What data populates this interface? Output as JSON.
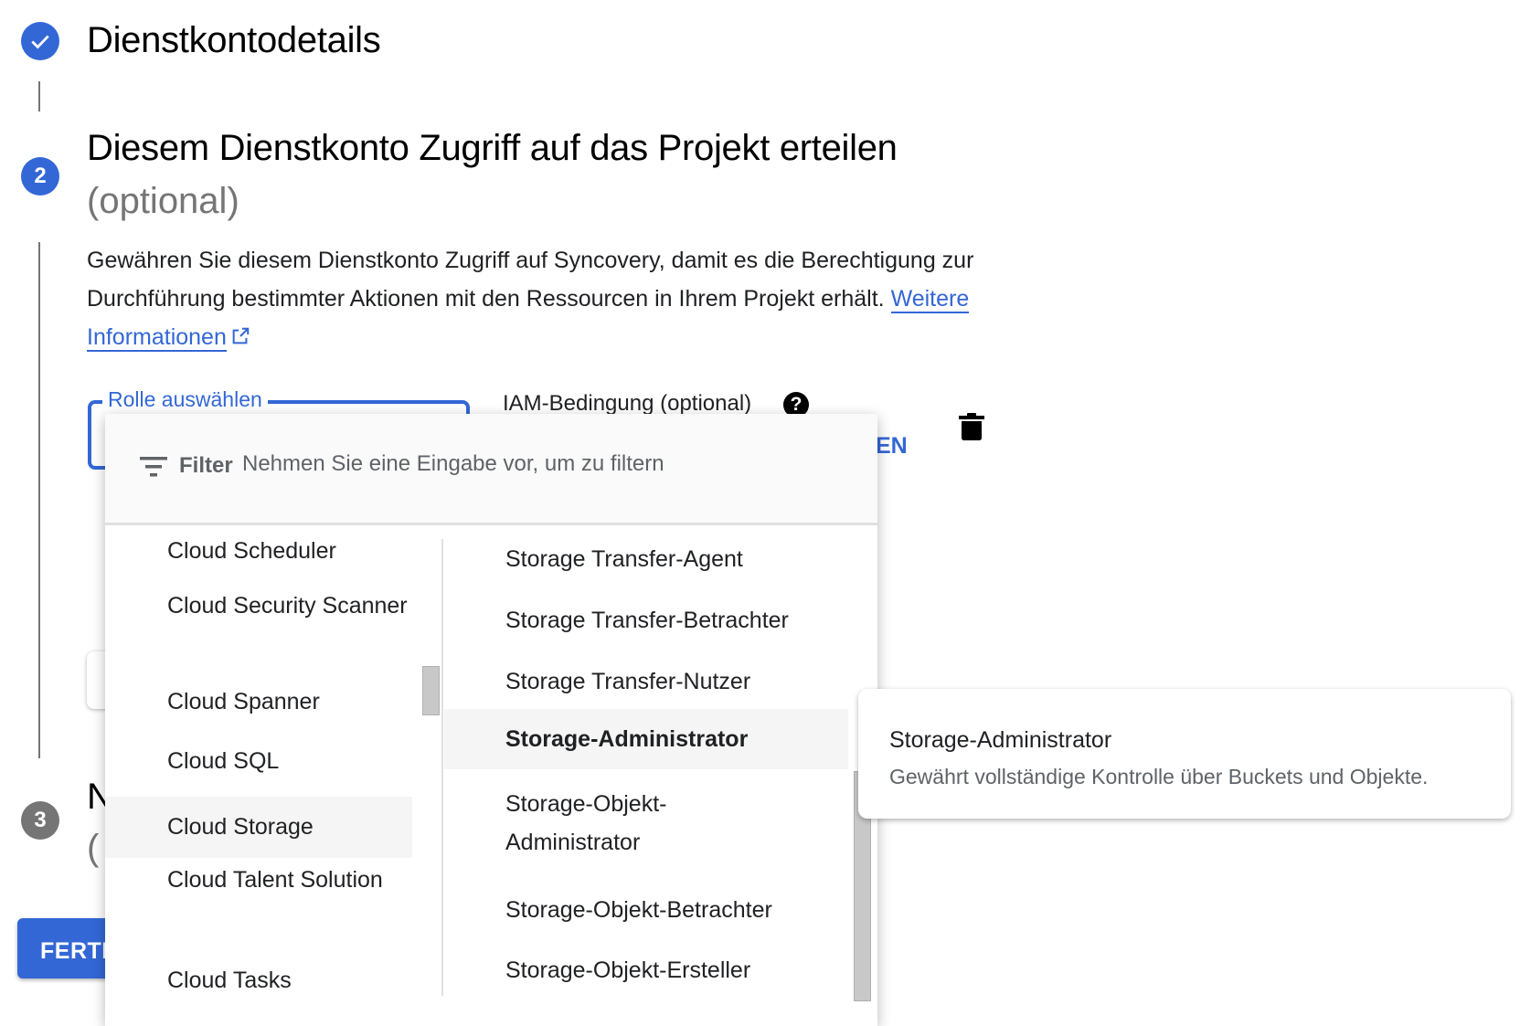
{
  "stepper": {
    "steps": [
      {
        "number": "",
        "state": "completed",
        "icon": "check-icon",
        "title": "Dienstkontodetails",
        "subtitle": ""
      },
      {
        "number": "2",
        "state": "active",
        "title": "Diesem Dienstkonto Zugriff auf das Projekt erteilen",
        "subtitle": "(optional)"
      },
      {
        "number": "3",
        "state": "pending",
        "title": "N",
        "subtitle": "("
      }
    ]
  },
  "step2": {
    "description": "Gewähren Sie diesem Dienstkonto Zugriff auf Syncovery, damit es die Berechtigung zur Durchführung bestimmter Aktionen mit den Ressourcen in Ihrem Projekt erhält.",
    "link_label": "Weitere Informationen",
    "link_icon": "external-link-icon",
    "role_field_label": "Rolle auswählen",
    "iam_condition_label": "IAM-Bedingung (optional)",
    "help_icon": "help-icon",
    "add_condition_label_visible": "EN",
    "delete_icon": "trash-icon"
  },
  "done_button_label_visible": "FERTI",
  "role_dropdown": {
    "filter_label": "Filter",
    "filter_placeholder": "Nehmen Sie eine Eingabe vor, um zu filtern",
    "filter_value": "",
    "services": [
      {
        "label": "Cloud Scheduler",
        "highlighted": false
      },
      {
        "label": "Cloud Security Scanner",
        "highlighted": false
      },
      {
        "label": "Cloud Spanner",
        "highlighted": false
      },
      {
        "label": "Cloud SQL",
        "highlighted": false
      },
      {
        "label": "Cloud Storage",
        "highlighted": true
      },
      {
        "label": "Cloud Talent Solution",
        "highlighted": false
      },
      {
        "label": "Cloud Tasks",
        "highlighted": false
      }
    ],
    "roles": [
      {
        "label": "Storage Transfer-Agent",
        "highlighted": false
      },
      {
        "label": "Storage Transfer-Betrachter",
        "highlighted": false
      },
      {
        "label": "Storage Transfer-Nutzer",
        "highlighted": false
      },
      {
        "label": "Storage-Administrator",
        "highlighted": true
      },
      {
        "label": "Storage-Objekt-Administrator",
        "highlighted": false
      },
      {
        "label": "Storage-Objekt-Betrachter",
        "highlighted": false
      },
      {
        "label": "Storage-Objekt-Ersteller",
        "highlighted": false
      }
    ]
  },
  "tooltip": {
    "title": "Storage-Administrator",
    "description": "Gewährt vollständige Kontrolle über Buckets und Objekte."
  }
}
